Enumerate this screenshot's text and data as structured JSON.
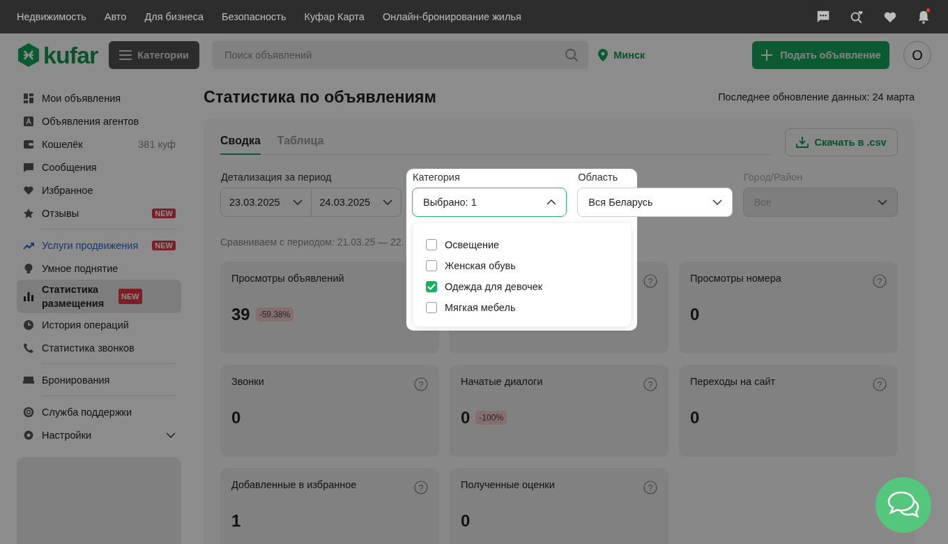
{
  "top_nav": {
    "links": [
      "Недвижимость",
      "Авто",
      "Для бизнеса",
      "Безопасность",
      "Куфар Карта",
      "Онлайн-бронирование жилья"
    ],
    "notifications_unread": true
  },
  "header": {
    "logo": "kufar",
    "categories_button": "Категории",
    "search": {
      "placeholder": "Поиск объявлений"
    },
    "location": "Минск",
    "post_button": "Подать объявление",
    "avatar": "О"
  },
  "sidebar": {
    "sections": [
      [
        {
          "label": "Мои объявления",
          "selected": false
        },
        {
          "label": "Объявления агентов",
          "selected": false
        },
        {
          "label": "Кошелёк",
          "count": "381 куф",
          "selected": false
        },
        {
          "label": "Сообщения",
          "selected": false
        },
        {
          "label": "Избранное",
          "selected": false
        },
        {
          "label": "Отзывы",
          "badge": "NEW",
          "selected": false
        }
      ],
      [
        {
          "label": "Услуги продвижения",
          "badge": "NEW",
          "accent": true,
          "selected": false
        },
        {
          "label": "Умное поднятие",
          "selected": false
        },
        {
          "label": "Статистика размещения",
          "badge": "NEW",
          "selected": true
        },
        {
          "label": "История операций",
          "selected": false
        },
        {
          "label": "Статистика звонков",
          "selected": false
        }
      ],
      [
        {
          "label": "Бронирования",
          "selected": false
        }
      ],
      [
        {
          "label": "Служба поддержки",
          "selected": false
        },
        {
          "label": "Настройки",
          "expanded": false,
          "selected": false
        }
      ]
    ]
  },
  "page": {
    "title": "Статистика по объявлениям",
    "updated": "Последнее обновление данных: 24 марта"
  },
  "tabs": [
    {
      "label": "Сводка",
      "selected": true
    },
    {
      "label": "Таблица",
      "selected": false
    }
  ],
  "download_button": "Скачать в .csv",
  "filters": {
    "period": {
      "label": "Детализация за период",
      "from": "23.03.2025",
      "to": "24.03.2025"
    },
    "category": {
      "label": "Категория",
      "value": "Выбрано: 1",
      "expanded": true,
      "options": [
        {
          "label": "Освещение",
          "checked": false
        },
        {
          "label": "Женская обувь",
          "checked": false
        },
        {
          "label": "Одежда для девочек",
          "checked": true
        },
        {
          "label": "Мягкая мебель",
          "checked": false
        }
      ]
    },
    "region": {
      "label": "Область",
      "value": "Вся Беларусь",
      "disabled": false
    },
    "city": {
      "label": "Город/Район",
      "value": "Все",
      "disabled": true
    }
  },
  "compare_text": "Сравниваем с периодом: 21.03.25 — 22.",
  "stats": [
    {
      "title": "Просмотры объявлений",
      "value": "39",
      "change": "-59.38%"
    },
    {
      "help": "?"
    },
    {
      "title": "Просмотры номера",
      "value": "0",
      "help": "?"
    },
    {
      "title": "Звонки",
      "value": "0",
      "help": "?"
    },
    {
      "title": "Начатые диалоги",
      "value": "0",
      "change": "-100%",
      "help": "?"
    },
    {
      "title": "Переходы на сайт",
      "value": "0",
      "help": "?"
    },
    {
      "title": "Добавленные в избранное",
      "value": "1",
      "help": "?"
    },
    {
      "title": "Полученные оценки",
      "value": "0",
      "help": "?"
    }
  ]
}
